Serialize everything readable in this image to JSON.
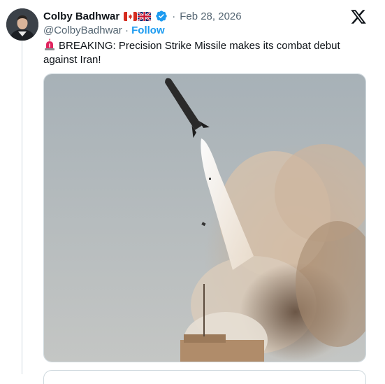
{
  "tweet": {
    "author_name": "Colby Badhwar",
    "flags": [
      "canada-flag",
      "uk-flag"
    ],
    "verified": true,
    "separator": "·",
    "date": "Feb 28, 2026",
    "handle": "@ColbyBadhwar",
    "follow_label": "Follow",
    "text": "BREAKING: Precision Strike Missile makes its combat debut against Iran!",
    "text_icon": "siren-emoji",
    "media_type": "photo-missile-launch"
  },
  "colors": {
    "link_blue": "#1d9bf0",
    "verified_blue": "#1d9bf0",
    "muted_text": "#536471",
    "primary_text": "#0f1419",
    "border": "#cfd9de"
  },
  "icons": {
    "platform_logo": "x-logo-icon",
    "verified_badge": "verified-badge-icon"
  }
}
